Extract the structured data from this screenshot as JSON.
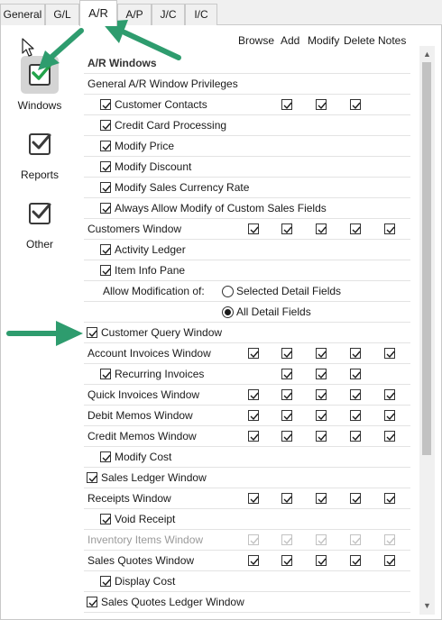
{
  "tabs": [
    {
      "label": "General",
      "active": false
    },
    {
      "label": "G/L",
      "active": false
    },
    {
      "label": "A/R",
      "active": true
    },
    {
      "label": "A/P",
      "active": false
    },
    {
      "label": "J/C",
      "active": false
    },
    {
      "label": "I/C",
      "active": false
    }
  ],
  "categories": [
    {
      "label": "Windows",
      "icon": "checkbox-green-icon",
      "selected": true
    },
    {
      "label": "Reports",
      "icon": "checkbox-icon",
      "selected": false
    },
    {
      "label": "Other",
      "icon": "checkbox-icon",
      "selected": false
    }
  ],
  "columns": [
    "Browse",
    "Add",
    "Modify",
    "Delete",
    "Notes"
  ],
  "rows": [
    {
      "type": "section",
      "label": "A/R Windows"
    },
    {
      "type": "plain",
      "label": "General A/R Window Privileges"
    },
    {
      "type": "sub",
      "label": "Customer Contacts",
      "checked": true,
      "cols": [
        false,
        true,
        true,
        true,
        false
      ],
      "has_cols": [
        false,
        true,
        true,
        true,
        false
      ]
    },
    {
      "type": "sub",
      "label": "Credit Card Processing",
      "checked": true,
      "cols": [],
      "has_cols": []
    },
    {
      "type": "sub",
      "label": "Modify Price",
      "checked": true,
      "cols": [],
      "has_cols": []
    },
    {
      "type": "sub",
      "label": "Modify Discount",
      "checked": true,
      "cols": [],
      "has_cols": []
    },
    {
      "type": "sub",
      "label": "Modify Sales Currency Rate",
      "checked": true,
      "cols": [],
      "has_cols": []
    },
    {
      "type": "sub",
      "label": "Always Allow Modify of Custom Sales Fields",
      "checked": true,
      "cols": [],
      "has_cols": []
    },
    {
      "type": "window",
      "label": "Customers Window",
      "cols": [
        true,
        true,
        true,
        true,
        true
      ],
      "has_cols": [
        true,
        true,
        true,
        true,
        true
      ]
    },
    {
      "type": "sub",
      "label": "Activity Ledger",
      "checked": true,
      "cols": [],
      "has_cols": []
    },
    {
      "type": "sub",
      "label": "Item Info Pane",
      "checked": true,
      "cols": [],
      "has_cols": []
    },
    {
      "type": "radio-row",
      "label": "Allow Modification of:",
      "options": [
        {
          "label": "Selected Detail Fields",
          "selected": false
        }
      ]
    },
    {
      "type": "radio-row2",
      "label": "",
      "options": [
        {
          "label": "All Detail Fields",
          "selected": true
        }
      ]
    },
    {
      "type": "lead",
      "label": "Customer Query Window",
      "checked": true,
      "cols": [],
      "has_cols": []
    },
    {
      "type": "window",
      "label": "Account Invoices Window",
      "cols": [
        true,
        true,
        true,
        true,
        true
      ],
      "has_cols": [
        true,
        true,
        true,
        true,
        true
      ]
    },
    {
      "type": "sub",
      "label": "Recurring Invoices",
      "checked": true,
      "cols": [
        false,
        true,
        true,
        true,
        false
      ],
      "has_cols": [
        false,
        true,
        true,
        true,
        false
      ]
    },
    {
      "type": "window",
      "label": "Quick Invoices Window",
      "cols": [
        true,
        true,
        true,
        true,
        true
      ],
      "has_cols": [
        true,
        true,
        true,
        true,
        true
      ]
    },
    {
      "type": "window",
      "label": "Debit Memos Window",
      "cols": [
        true,
        true,
        true,
        true,
        true
      ],
      "has_cols": [
        true,
        true,
        true,
        true,
        true
      ]
    },
    {
      "type": "window",
      "label": "Credit Memos Window",
      "cols": [
        true,
        true,
        true,
        true,
        true
      ],
      "has_cols": [
        true,
        true,
        true,
        true,
        true
      ]
    },
    {
      "type": "sub",
      "label": "Modify Cost",
      "checked": true,
      "cols": [],
      "has_cols": []
    },
    {
      "type": "lead",
      "label": "Sales Ledger Window",
      "checked": true,
      "cols": [],
      "has_cols": []
    },
    {
      "type": "window",
      "label": "Receipts Window",
      "cols": [
        true,
        true,
        true,
        true,
        true
      ],
      "has_cols": [
        true,
        true,
        true,
        true,
        true
      ]
    },
    {
      "type": "sub",
      "label": "Void Receipt",
      "checked": true,
      "cols": [],
      "has_cols": []
    },
    {
      "type": "window-disabled",
      "label": "Inventory Items Window",
      "cols": [
        true,
        true,
        true,
        true,
        true
      ],
      "has_cols": [
        true,
        true,
        true,
        true,
        true
      ]
    },
    {
      "type": "window",
      "label": "Sales Quotes Window",
      "cols": [
        true,
        true,
        true,
        true,
        true
      ],
      "has_cols": [
        true,
        true,
        true,
        true,
        true
      ]
    },
    {
      "type": "sub",
      "label": "Display Cost",
      "checked": true,
      "cols": [],
      "has_cols": []
    },
    {
      "type": "lead",
      "label": "Sales Quotes Ledger Window",
      "checked": true,
      "cols": [],
      "has_cols": []
    }
  ],
  "colors": {
    "arrow": "#2e9c6e",
    "check_green": "#22a34a"
  }
}
